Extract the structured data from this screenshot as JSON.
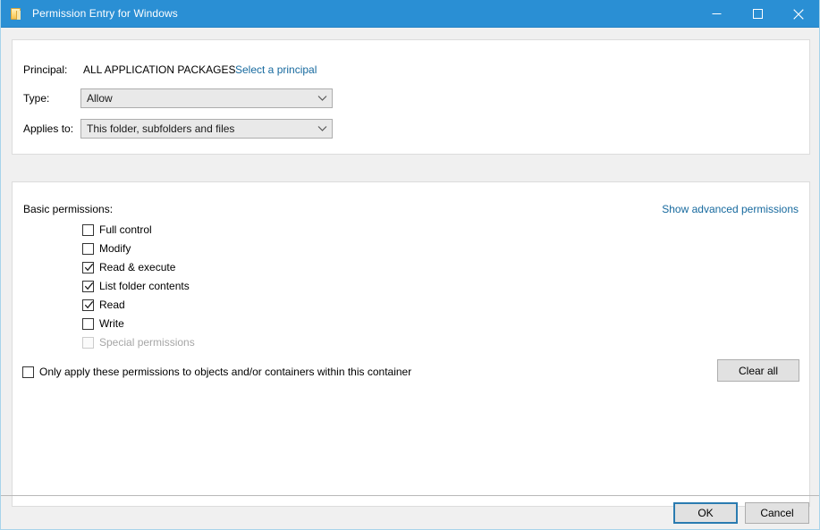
{
  "window": {
    "title": "Permission Entry for Windows",
    "icon": "folder-icon",
    "minimize_label": "Minimize",
    "maximize_label": "Maximize",
    "close_label": "Close",
    "accent_color": "#2a8fd4",
    "link_color": "#16699e"
  },
  "principal_section": {
    "principal_label": "Principal:",
    "principal_value": "ALL APPLICATION PACKAGES",
    "select_principal_link": "Select a principal",
    "type_label": "Type:",
    "type_value": "Allow",
    "applies_to_label": "Applies to:",
    "applies_to_value": "This folder, subfolders and files"
  },
  "permissions_section": {
    "heading": "Basic permissions:",
    "advanced_link": "Show advanced permissions",
    "items": [
      {
        "label": "Full control",
        "checked": false,
        "disabled": false
      },
      {
        "label": "Modify",
        "checked": false,
        "disabled": false
      },
      {
        "label": "Read & execute",
        "checked": true,
        "disabled": false
      },
      {
        "label": "List folder contents",
        "checked": true,
        "disabled": false
      },
      {
        "label": "Read",
        "checked": true,
        "disabled": false
      },
      {
        "label": "Write",
        "checked": false,
        "disabled": false
      },
      {
        "label": "Special permissions",
        "checked": false,
        "disabled": true
      }
    ],
    "only_apply_label": "Only apply these permissions to objects and/or containers within this container",
    "only_apply_checked": false,
    "clear_all_label": "Clear all"
  },
  "footer": {
    "ok_label": "OK",
    "cancel_label": "Cancel"
  }
}
